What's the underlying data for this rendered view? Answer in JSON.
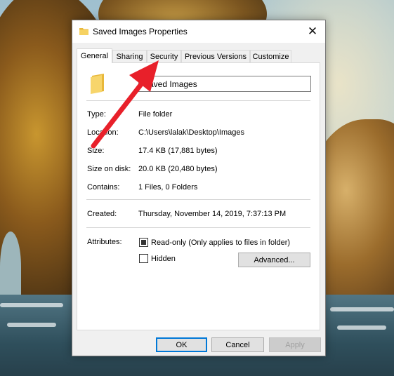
{
  "window": {
    "title": "Saved Images Properties",
    "close_glyph": "✕"
  },
  "tabs": [
    {
      "label": "General",
      "active": true
    },
    {
      "label": "Sharing",
      "active": false
    },
    {
      "label": "Security",
      "active": false
    },
    {
      "label": "Previous Versions",
      "active": false
    },
    {
      "label": "Customize",
      "active": false
    }
  ],
  "general": {
    "name_value": "Saved Images",
    "type": {
      "label": "Type:",
      "value": "File folder"
    },
    "location": {
      "label": "Location:",
      "value": "C:\\Users\\lalak\\Desktop\\Images"
    },
    "size": {
      "label": "Size:",
      "value": "17.4 KB (17,881 bytes)"
    },
    "size_on_disk": {
      "label": "Size on disk:",
      "value": "20.0 KB (20,480 bytes)"
    },
    "contains": {
      "label": "Contains:",
      "value": "1 Files, 0 Folders"
    },
    "created": {
      "label": "Created:",
      "value": "Thursday, November 14, 2019, 7:37:13 PM"
    },
    "attributes": {
      "label": "Attributes:",
      "readonly": {
        "label": "Read-only (Only applies to files in folder)",
        "checked": true
      },
      "hidden": {
        "label": "Hidden",
        "checked": false
      },
      "advanced_button": "Advanced..."
    }
  },
  "footer": {
    "ok": "OK",
    "cancel": "Cancel",
    "apply": "Apply",
    "apply_enabled": false
  },
  "colors": {
    "arrow": "#e8202a",
    "folder": "#f0c040",
    "default_button_border": "#0078d7"
  },
  "icons": {
    "folder": "folder-icon",
    "close": "close-icon",
    "annotation": "red-arrow"
  }
}
